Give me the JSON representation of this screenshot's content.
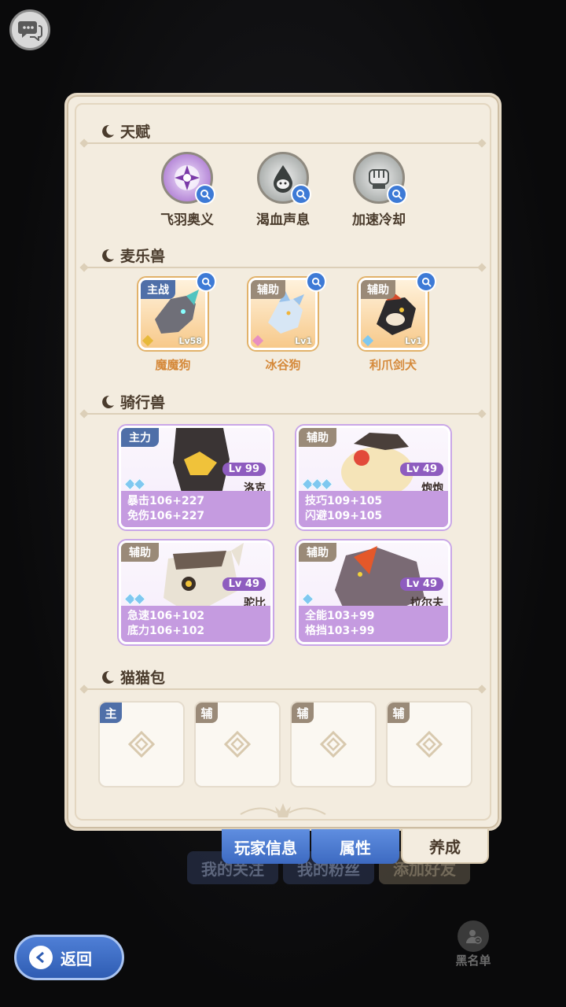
{
  "sections": {
    "talent": "天赋",
    "pets": "麦乐兽",
    "mounts": "骑行兽",
    "catbag": "猫猫包"
  },
  "talents": [
    {
      "name": "飞羽奥义",
      "icon": "shuriken-icon"
    },
    {
      "name": "渴血声息",
      "icon": "drop-icon"
    },
    {
      "name": "加速冷却",
      "icon": "fist-icon"
    }
  ],
  "pets": [
    {
      "role": "主战",
      "name": "魔魔狗",
      "level": "Lv58"
    },
    {
      "role": "辅助",
      "name": "冰谷狗",
      "level": "Lv1"
    },
    {
      "role": "辅助",
      "name": "利爪剑犬",
      "level": "Lv1"
    }
  ],
  "mounts": [
    {
      "role": "主力",
      "level": "Lv 99",
      "name": "洛克",
      "stat1": "暴击106+227",
      "stat2": "免伤106+227",
      "stars": 2
    },
    {
      "role": "辅助",
      "level": "Lv 49",
      "name": "炮炮",
      "stat1": "技巧109+105",
      "stat2": "闪避109+105",
      "stars": 3
    },
    {
      "role": "辅助",
      "level": "Lv 49",
      "name": "驼比",
      "stat1": "急速106+102",
      "stat2": "底力106+102",
      "stars": 2
    },
    {
      "role": "辅助",
      "level": "Lv 49",
      "name": "拉尔夫",
      "stat1": "全能103+99",
      "stat2": "格挡103+99",
      "stars": 1
    }
  ],
  "catbag": [
    {
      "role": "主"
    },
    {
      "role": "辅"
    },
    {
      "role": "辅"
    },
    {
      "role": "辅"
    }
  ],
  "tabs": {
    "player_info": "玩家信息",
    "attributes": "属性",
    "nurture": "养成"
  },
  "background": {
    "my_follow": "我的关注",
    "my_fans": "我的粉丝",
    "add_friend": "添加好友"
  },
  "back_label": "返回",
  "blacklist_label": "黑名单",
  "colors": {
    "panel": "#f3ecdf",
    "accent_blue": "#3d6ac1",
    "mount_purple": "#c59be0",
    "pet_orange": "#d5893a"
  }
}
